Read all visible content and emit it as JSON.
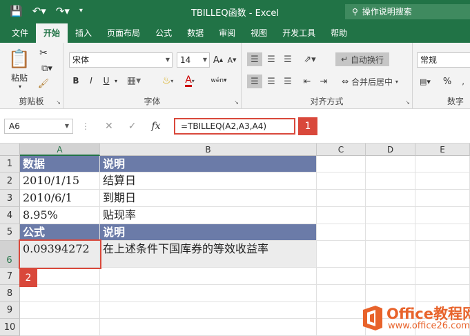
{
  "titlebar": {
    "title": "TBILLEQ函数 - Excel",
    "search_placeholder": "操作说明搜索",
    "bg": "#217346"
  },
  "tabs": [
    "文件",
    "开始",
    "插入",
    "页面布局",
    "公式",
    "数据",
    "审阅",
    "视图",
    "开发工具",
    "帮助"
  ],
  "ribbon": {
    "clipboard": {
      "paste": "粘贴",
      "label": "剪贴板"
    },
    "font": {
      "name": "宋体",
      "size": "14",
      "bold": "B",
      "italic": "I",
      "underline": "U",
      "label": "字体",
      "grow": "A",
      "shrink": "A",
      "wen": "wén"
    },
    "alignment": {
      "wrap": "自动换行",
      "merge": "合并后居中",
      "label": "对齐方式"
    },
    "number": {
      "format": "常规",
      "percent": "%",
      "label": "数字"
    }
  },
  "formula_bar": {
    "namebox": "A6",
    "formula": "=TBILLEQ(A2,A3,A4)",
    "fx": "fx"
  },
  "badges": [
    "1",
    "2"
  ],
  "columns": [
    "A",
    "B",
    "C",
    "D",
    "E"
  ],
  "rows": [
    "1",
    "2",
    "3",
    "4",
    "5",
    "6",
    "7",
    "8",
    "9",
    "10"
  ],
  "cells": {
    "a1": "数据",
    "b1": "说明",
    "a2": "2010/1/15",
    "b2": "结算日",
    "a3": "2010/6/1",
    "b3": "到期日",
    "a4": "8.95%",
    "b4": "贴现率",
    "a5": "公式",
    "b5": "说明",
    "a6": "0.09394272",
    "b6": "在上述条件下国库券的等效收益率"
  },
  "header_fill": "#6b7ba8",
  "highlight_color": "#d9483b",
  "watermark": {
    "brand": "Office教程网",
    "url": "www.office26.com"
  }
}
